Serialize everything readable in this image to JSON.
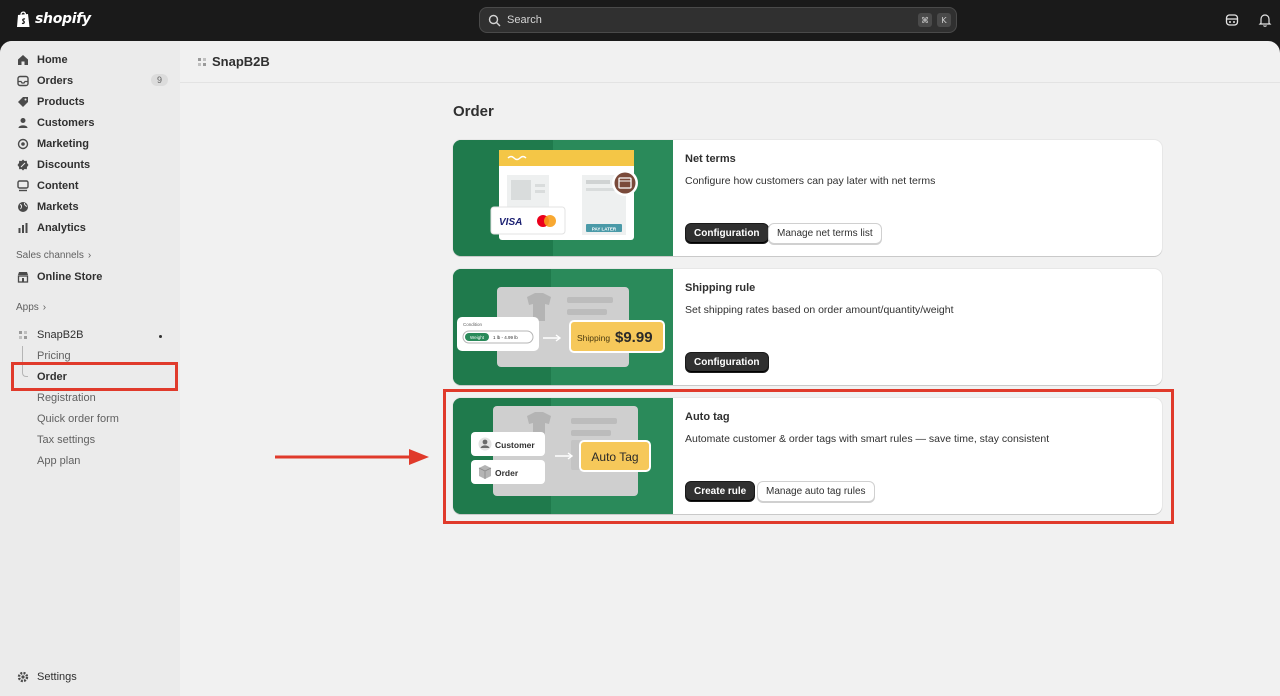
{
  "topbar": {
    "brand": "shopify",
    "search_placeholder": "Search",
    "shortcut_keys": [
      "⌘",
      "K"
    ]
  },
  "sidebar": {
    "items": [
      {
        "label": "Home",
        "icon": "home-icon"
      },
      {
        "label": "Orders",
        "icon": "inbox-icon",
        "badge": "9"
      },
      {
        "label": "Products",
        "icon": "tag-icon"
      },
      {
        "label": "Customers",
        "icon": "person-icon"
      },
      {
        "label": "Marketing",
        "icon": "target-icon"
      },
      {
        "label": "Discounts",
        "icon": "discount-icon"
      },
      {
        "label": "Content",
        "icon": "content-icon"
      },
      {
        "label": "Markets",
        "icon": "globe-icon"
      },
      {
        "label": "Analytics",
        "icon": "bar-chart-icon"
      }
    ],
    "sales_channels_label": "Sales channels",
    "online_store_label": "Online Store",
    "apps_label": "Apps",
    "app": {
      "name": "SnapB2B",
      "subitems": [
        "Pricing",
        "Order",
        "Registration",
        "Quick order form",
        "Tax settings",
        "App plan"
      ],
      "active_subitem": "Order"
    },
    "settings_label": "Settings"
  },
  "header": {
    "app_title": "SnapB2B"
  },
  "main": {
    "title": "Order",
    "cards": [
      {
        "title": "Net terms",
        "description": "Configure how customers can pay later with net terms",
        "buttons": [
          "Configuration",
          "Manage net terms list"
        ],
        "art": {
          "card_brand": "VISA",
          "pill": "PAY LATER"
        }
      },
      {
        "title": "Shipping rule",
        "description": "Set shipping rates based on order amount/quantity/weight",
        "buttons": [
          "Configuration"
        ],
        "art": {
          "condition_label": "Condition",
          "weight_chip": "Weight",
          "weight_range": "1 lb - 4.99 lb",
          "shipping_label": "Shipping",
          "price": "$9.99"
        }
      },
      {
        "title": "Auto tag",
        "description": "Automate customer & order tags with smart rules — save time, stay consistent",
        "buttons": [
          "Create rule",
          "Manage auto tag rules"
        ],
        "art": {
          "customer_label": "Customer",
          "order_label": "Order",
          "tag_label": "Auto Tag"
        }
      }
    ]
  },
  "colors": {
    "highlight": "#e03a2b",
    "card_art_green": "#2a8a5a",
    "primary_button": "#303030"
  }
}
